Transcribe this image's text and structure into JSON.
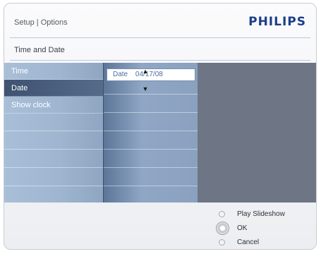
{
  "header": {
    "breadcrumb": "Setup | Options",
    "brand": "PHILIPS"
  },
  "section_title": "Time and Date",
  "menu": {
    "items": [
      {
        "label": "Time",
        "selected": false
      },
      {
        "label": "Date",
        "selected": true
      },
      {
        "label": "Show clock",
        "selected": false
      }
    ]
  },
  "date_editor": {
    "label": "Date",
    "value": "04/17/08"
  },
  "options": [
    {
      "label": "Play Slideshow",
      "active": false
    },
    {
      "label": "OK",
      "active": true
    },
    {
      "label": "Cancel",
      "active": false
    }
  ],
  "colors": {
    "brand": "#1c3d8a",
    "selected_item": "#3f5270",
    "panel_background": "#6d7481"
  }
}
